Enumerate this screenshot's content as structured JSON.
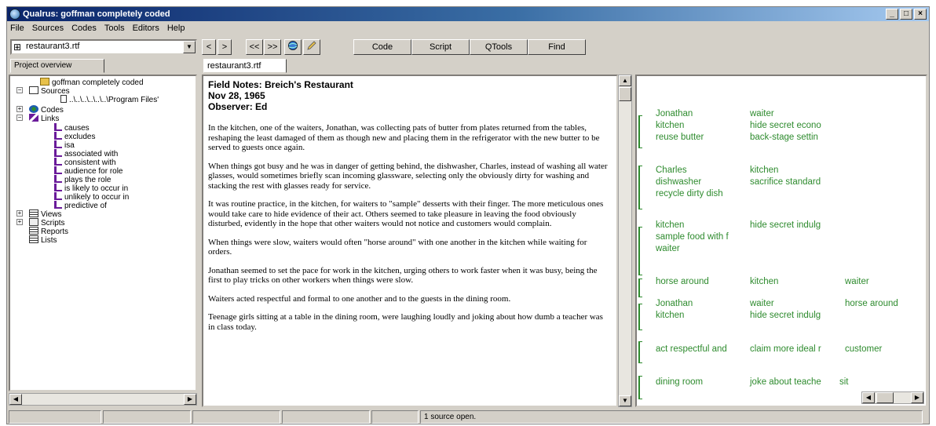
{
  "window": {
    "title": "Qualrus: goffman completely coded",
    "controls": [
      "_",
      "□",
      "×"
    ]
  },
  "menu": [
    "File",
    "Sources",
    "Codes",
    "Tools",
    "Editors",
    "Help"
  ],
  "toolbar": {
    "source_select": "restaurant3.rtf",
    "nav": [
      "<",
      ">",
      "<<",
      ">>"
    ],
    "buttons": [
      "Code",
      "Script",
      "QTools",
      "Find"
    ]
  },
  "project_tab": "Project overview",
  "tree": [
    {
      "label": "goffman completely coded",
      "icon": "folder-icon"
    },
    {
      "label": "Sources",
      "icon": "sources-icon"
    },
    {
      "label": "..\\..\\..\\..\\..\\..\\Program Files'",
      "icon": "document-icon"
    },
    {
      "label": "Codes",
      "icon": "codes-icon"
    },
    {
      "label": "Links",
      "icon": "links-icon"
    },
    {
      "label": "causes",
      "icon": "link-icon"
    },
    {
      "label": "excludes",
      "icon": "link-icon"
    },
    {
      "label": "isa",
      "icon": "link-icon"
    },
    {
      "label": "associated with",
      "icon": "link-icon"
    },
    {
      "label": "consistent with",
      "icon": "link-icon"
    },
    {
      "label": "audience for role",
      "icon": "link-icon"
    },
    {
      "label": "plays the role",
      "icon": "link-icon"
    },
    {
      "label": "is likely to occur in",
      "icon": "link-icon"
    },
    {
      "label": "unlikely to occur in",
      "icon": "link-icon"
    },
    {
      "label": "predictive of",
      "icon": "link-icon"
    },
    {
      "label": "Views",
      "icon": "views-icon"
    },
    {
      "label": "Scripts",
      "icon": "scripts-icon"
    },
    {
      "label": "Reports",
      "icon": "reports-icon"
    },
    {
      "label": "Lists",
      "icon": "lists-icon"
    }
  ],
  "doc_tab": "restaurant3.rtf",
  "document": {
    "heading": [
      "Field Notes: Breich's Restaurant",
      "Nov 28, 1965",
      "Observer: Ed"
    ],
    "paragraphs": [
      "In the kitchen, one of the waiters, Jonathan, was collecting pats of butter from plates returned from the tables, reshaping the least damaged of them as though new and placing them in the refrigerator with the new butter to be served to guests once again.",
      "When things got busy and he was in danger of getting behind, the dishwasher, Charles, instead of washing all water glasses, would sometimes briefly scan incoming glassware, selecting only the obviously dirty for washing and stacking the rest with glasses ready for service.",
      "It was routine practice, in the kitchen, for waiters to \"sample\" desserts with their finger.  The more meticulous ones would take care to hide evidence of their act. Others seemed to take pleasure in leaving the food obviously disturbed, evidently in the hope that other waiters would not notice and customers would complain.",
      "When things were slow, waiters would often \"horse around\" with one another in the kitchen while waiting for orders.",
      "Jonathan seemed to set the pace for work in the kitchen, urging others to work faster when it was busy, being the first to play tricks on other workers when things were slow.",
      "Waiters acted respectful and formal to one another and to the guests in the dining room.",
      "Teenage girls sitting at a table in the dining room, were laughing loudly and joking about how dumb a teacher was in class today."
    ]
  },
  "code_groups": [
    [
      [
        "Jonathan",
        "waiter",
        ""
      ],
      [
        "kitchen",
        "hide secret econo",
        ""
      ],
      [
        "reuse butter",
        "back-stage settin",
        ""
      ]
    ],
    [
      [
        "Charles",
        "kitchen",
        ""
      ],
      [
        "dishwasher",
        "sacrifice standard",
        ""
      ],
      [
        "recycle dirty dish",
        "",
        ""
      ]
    ],
    [
      [
        "kitchen",
        "hide secret indulg",
        ""
      ],
      [
        "sample food with f",
        "",
        ""
      ],
      [
        "waiter",
        "",
        ""
      ]
    ],
    [
      [
        "horse around",
        "kitchen",
        "waiter"
      ]
    ],
    [
      [
        "Jonathan",
        "waiter",
        "horse around"
      ],
      [
        "kitchen",
        "hide secret indulg",
        ""
      ]
    ],
    [
      [
        "act respectful and",
        "claim more ideal r",
        "customer"
      ]
    ],
    [
      [
        "dining room",
        "joke about teache",
        "sit"
      ]
    ]
  ],
  "status": {
    "message": "1 source open."
  }
}
